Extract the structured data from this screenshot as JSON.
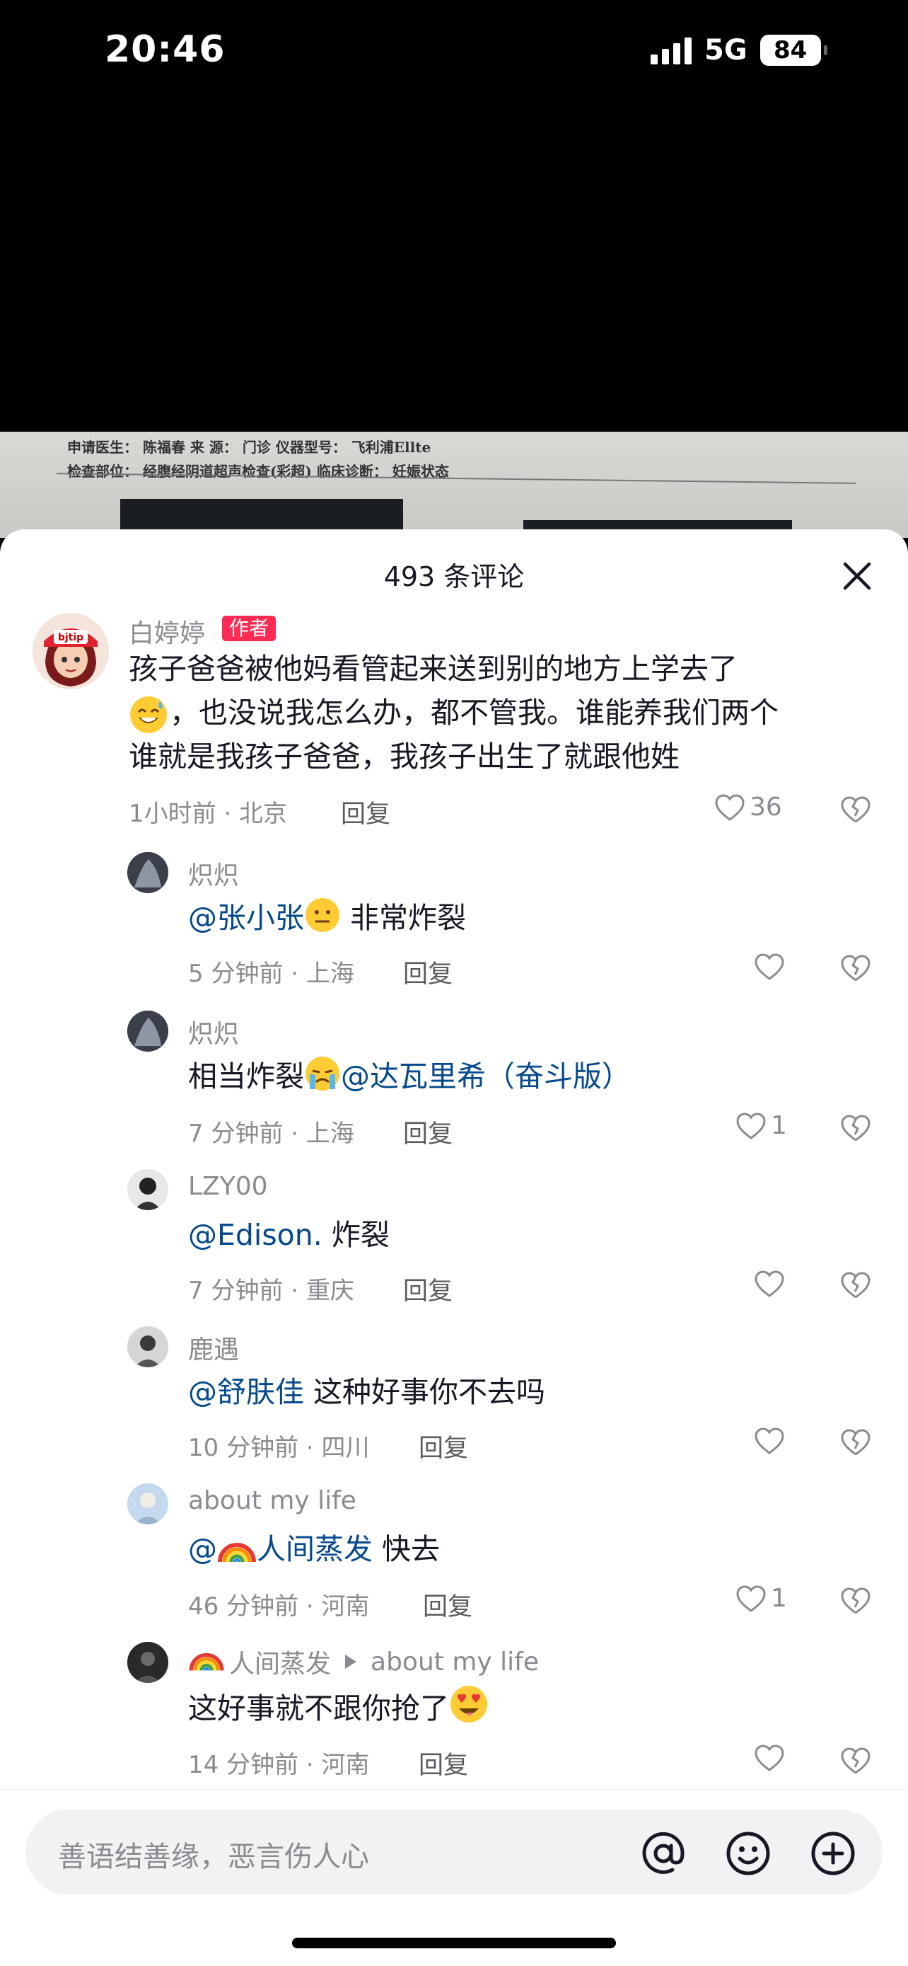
{
  "status_bar": {
    "time": "20:46",
    "network": "5G",
    "battery": "84"
  },
  "document": {
    "line1": "申请医生：  陈福春          来   源：  门诊                                仪器型号：          飞利浦Ellte",
    "line2": "检查部位：  经腹经阴道超声检查(彩超)                   临床诊断：  妊娠状态"
  },
  "comments_sheet": {
    "title": "493 条评论",
    "main_comment": {
      "author": "白婷婷",
      "author_tag": "作者",
      "text_line1": "孩子爸爸被他妈看管起来送到别的地方上学去了",
      "text_line2": "，也没说我怎么办，都不管我。谁能养我们两个",
      "text_line3": "谁就是我孩子爸爸，我孩子出生了就跟他姓",
      "meta": "1小时前 · 北京",
      "reply_label": "回复",
      "likes": "36"
    },
    "replies": [
      {
        "author": "炽炽",
        "mention": "@张小张",
        "text": " 非常炸裂",
        "meta": "5 分钟前 · 上海",
        "reply_label": "回复",
        "likes": ""
      },
      {
        "author": "炽炽",
        "text_before": "相当炸裂",
        "mention": "@达瓦里希（奋斗版）",
        "meta": "7 分钟前 · 上海",
        "reply_label": "回复",
        "likes": "1"
      },
      {
        "author": "LZY00",
        "mention": "@Edison.",
        "text": " 炸裂",
        "meta": "7 分钟前 · 重庆",
        "reply_label": "回复",
        "likes": ""
      },
      {
        "author": "鹿遇",
        "mention": "@舒肤佳",
        "text": " 这种好事你不去吗",
        "meta": "10 分钟前 · 四川",
        "reply_label": "回复",
        "likes": ""
      },
      {
        "author": "about my life",
        "mention_prefix": "@",
        "mention": "人间蒸发",
        "text": " 快去",
        "meta": "46 分钟前 · 河南",
        "reply_label": "回复",
        "likes": "1"
      },
      {
        "author": "人间蒸发",
        "reply_to": "about my life",
        "text": "这好事就不跟你抢了",
        "meta": "14 分钟前 · 河南",
        "reply_label": "回复",
        "likes": ""
      }
    ]
  },
  "input_bar": {
    "placeholder": "善语结善缘，恶言伤人心"
  },
  "colors": {
    "accent": "#fe2c55",
    "mention": "#04498d",
    "muted": "#8a8b91"
  }
}
